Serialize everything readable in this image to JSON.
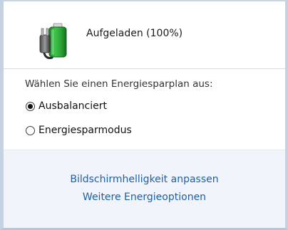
{
  "battery": {
    "status_text": "Aufgeladen (100%)",
    "icon": "battery-plugged-icon",
    "charge_fraction": 1.0
  },
  "plan": {
    "heading": "Wählen Sie einen Energiesparplan aus:",
    "options": [
      {
        "label": "Ausbalanciert",
        "selected": true
      },
      {
        "label": "Energiesparmodus",
        "selected": false
      }
    ]
  },
  "links": {
    "brightness": "Bildschirmhelligkeit anpassen",
    "more_options": "Weitere Energieoptionen"
  },
  "colors": {
    "link": "#1c5fa8",
    "battery_fill": "#2fae3a",
    "panel_bg": "#f1f5fb"
  }
}
